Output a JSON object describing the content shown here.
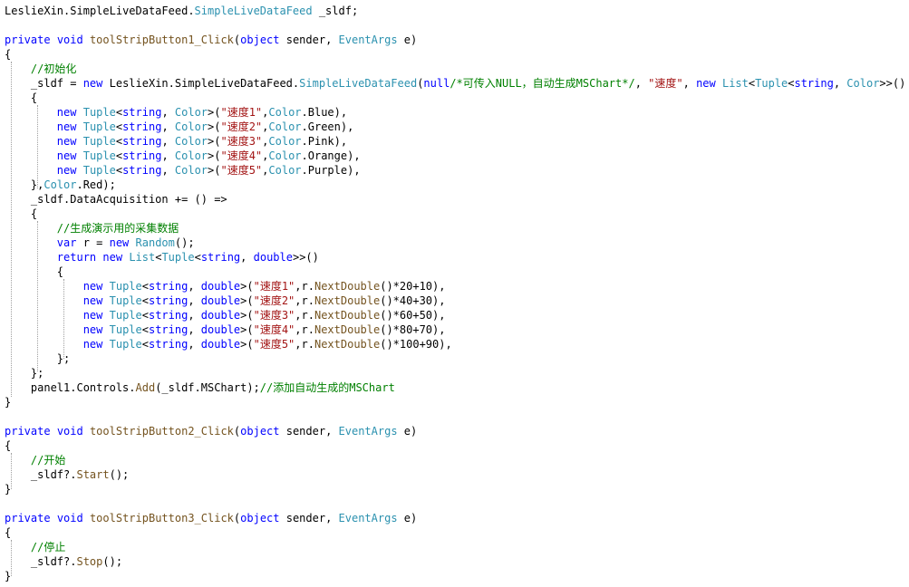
{
  "code_lines": [
    [
      [
        "id",
        "LeslieXin"
      ],
      [
        "punc",
        "."
      ],
      [
        "id",
        "SimpleLiveDataFeed"
      ],
      [
        "punc",
        "."
      ],
      [
        "type",
        "SimpleLiveDataFeed"
      ],
      [
        "punc",
        " _sldf;"
      ]
    ],
    [],
    [
      [
        "kw",
        "private"
      ],
      [
        "punc",
        " "
      ],
      [
        "kw",
        "void"
      ],
      [
        "punc",
        " "
      ],
      [
        "method",
        "toolStripButton1_Click"
      ],
      [
        "punc",
        "("
      ],
      [
        "kw",
        "object"
      ],
      [
        "punc",
        " sender, "
      ],
      [
        "type",
        "EventArgs"
      ],
      [
        "punc",
        " e)"
      ]
    ],
    [
      [
        "punc",
        "{"
      ]
    ],
    [
      [
        "punc",
        "    "
      ],
      [
        "com",
        "//初始化"
      ]
    ],
    [
      [
        "punc",
        "    _sldf = "
      ],
      [
        "kw",
        "new"
      ],
      [
        "punc",
        " LeslieXin.SimpleLiveDataFeed."
      ],
      [
        "type",
        "SimpleLiveDataFeed"
      ],
      [
        "punc",
        "("
      ],
      [
        "kw",
        "null"
      ],
      [
        "com",
        "/*可传入NULL，自动生成MSChart*/"
      ],
      [
        "punc",
        ", "
      ],
      [
        "str",
        "\"速度\""
      ],
      [
        "punc",
        ", "
      ],
      [
        "kw",
        "new"
      ],
      [
        "punc",
        " "
      ],
      [
        "type",
        "List"
      ],
      [
        "punc",
        "<"
      ],
      [
        "type",
        "Tuple"
      ],
      [
        "punc",
        "<"
      ],
      [
        "kw",
        "string"
      ],
      [
        "punc",
        ", "
      ],
      [
        "type",
        "Color"
      ],
      [
        "punc",
        ">>()"
      ]
    ],
    [
      [
        "punc",
        "    {"
      ]
    ],
    [
      [
        "punc",
        "        "
      ],
      [
        "kw",
        "new"
      ],
      [
        "punc",
        " "
      ],
      [
        "type",
        "Tuple"
      ],
      [
        "punc",
        "<"
      ],
      [
        "kw",
        "string"
      ],
      [
        "punc",
        ", "
      ],
      [
        "type",
        "Color"
      ],
      [
        "punc",
        ">("
      ],
      [
        "str",
        "\"速度1\""
      ],
      [
        "punc",
        ","
      ],
      [
        "type",
        "Color"
      ],
      [
        "punc",
        ".Blue),"
      ]
    ],
    [
      [
        "punc",
        "        "
      ],
      [
        "kw",
        "new"
      ],
      [
        "punc",
        " "
      ],
      [
        "type",
        "Tuple"
      ],
      [
        "punc",
        "<"
      ],
      [
        "kw",
        "string"
      ],
      [
        "punc",
        ", "
      ],
      [
        "type",
        "Color"
      ],
      [
        "punc",
        ">("
      ],
      [
        "str",
        "\"速度2\""
      ],
      [
        "punc",
        ","
      ],
      [
        "type",
        "Color"
      ],
      [
        "punc",
        ".Green),"
      ]
    ],
    [
      [
        "punc",
        "        "
      ],
      [
        "kw",
        "new"
      ],
      [
        "punc",
        " "
      ],
      [
        "type",
        "Tuple"
      ],
      [
        "punc",
        "<"
      ],
      [
        "kw",
        "string"
      ],
      [
        "punc",
        ", "
      ],
      [
        "type",
        "Color"
      ],
      [
        "punc",
        ">("
      ],
      [
        "str",
        "\"速度3\""
      ],
      [
        "punc",
        ","
      ],
      [
        "type",
        "Color"
      ],
      [
        "punc",
        ".Pink),"
      ]
    ],
    [
      [
        "punc",
        "        "
      ],
      [
        "kw",
        "new"
      ],
      [
        "punc",
        " "
      ],
      [
        "type",
        "Tuple"
      ],
      [
        "punc",
        "<"
      ],
      [
        "kw",
        "string"
      ],
      [
        "punc",
        ", "
      ],
      [
        "type",
        "Color"
      ],
      [
        "punc",
        ">("
      ],
      [
        "str",
        "\"速度4\""
      ],
      [
        "punc",
        ","
      ],
      [
        "type",
        "Color"
      ],
      [
        "punc",
        ".Orange),"
      ]
    ],
    [
      [
        "punc",
        "        "
      ],
      [
        "kw",
        "new"
      ],
      [
        "punc",
        " "
      ],
      [
        "type",
        "Tuple"
      ],
      [
        "punc",
        "<"
      ],
      [
        "kw",
        "string"
      ],
      [
        "punc",
        ", "
      ],
      [
        "type",
        "Color"
      ],
      [
        "punc",
        ">("
      ],
      [
        "str",
        "\"速度5\""
      ],
      [
        "punc",
        ","
      ],
      [
        "type",
        "Color"
      ],
      [
        "punc",
        ".Purple),"
      ]
    ],
    [
      [
        "punc",
        "    },"
      ],
      [
        "type",
        "Color"
      ],
      [
        "punc",
        ".Red);"
      ]
    ],
    [
      [
        "punc",
        "    _sldf.DataAcquisition += () =>"
      ]
    ],
    [
      [
        "punc",
        "    {"
      ]
    ],
    [
      [
        "punc",
        "        "
      ],
      [
        "com",
        "//生成演示用的采集数据"
      ]
    ],
    [
      [
        "punc",
        "        "
      ],
      [
        "kw",
        "var"
      ],
      [
        "punc",
        " r = "
      ],
      [
        "kw",
        "new"
      ],
      [
        "punc",
        " "
      ],
      [
        "type",
        "Random"
      ],
      [
        "punc",
        "();"
      ]
    ],
    [
      [
        "punc",
        "        "
      ],
      [
        "kw",
        "return"
      ],
      [
        "punc",
        " "
      ],
      [
        "kw",
        "new"
      ],
      [
        "punc",
        " "
      ],
      [
        "type",
        "List"
      ],
      [
        "punc",
        "<"
      ],
      [
        "type",
        "Tuple"
      ],
      [
        "punc",
        "<"
      ],
      [
        "kw",
        "string"
      ],
      [
        "punc",
        ", "
      ],
      [
        "kw",
        "double"
      ],
      [
        "punc",
        ">>()"
      ]
    ],
    [
      [
        "punc",
        "        {"
      ]
    ],
    [
      [
        "punc",
        "            "
      ],
      [
        "kw",
        "new"
      ],
      [
        "punc",
        " "
      ],
      [
        "type",
        "Tuple"
      ],
      [
        "punc",
        "<"
      ],
      [
        "kw",
        "string"
      ],
      [
        "punc",
        ", "
      ],
      [
        "kw",
        "double"
      ],
      [
        "punc",
        ">("
      ],
      [
        "str",
        "\"速度1\""
      ],
      [
        "punc",
        ",r."
      ],
      [
        "method",
        "NextDouble"
      ],
      [
        "punc",
        "()*20+10),"
      ]
    ],
    [
      [
        "punc",
        "            "
      ],
      [
        "kw",
        "new"
      ],
      [
        "punc",
        " "
      ],
      [
        "type",
        "Tuple"
      ],
      [
        "punc",
        "<"
      ],
      [
        "kw",
        "string"
      ],
      [
        "punc",
        ", "
      ],
      [
        "kw",
        "double"
      ],
      [
        "punc",
        ">("
      ],
      [
        "str",
        "\"速度2\""
      ],
      [
        "punc",
        ",r."
      ],
      [
        "method",
        "NextDouble"
      ],
      [
        "punc",
        "()*40+30),"
      ]
    ],
    [
      [
        "punc",
        "            "
      ],
      [
        "kw",
        "new"
      ],
      [
        "punc",
        " "
      ],
      [
        "type",
        "Tuple"
      ],
      [
        "punc",
        "<"
      ],
      [
        "kw",
        "string"
      ],
      [
        "punc",
        ", "
      ],
      [
        "kw",
        "double"
      ],
      [
        "punc",
        ">("
      ],
      [
        "str",
        "\"速度3\""
      ],
      [
        "punc",
        ",r."
      ],
      [
        "method",
        "NextDouble"
      ],
      [
        "punc",
        "()*60+50),"
      ]
    ],
    [
      [
        "punc",
        "            "
      ],
      [
        "kw",
        "new"
      ],
      [
        "punc",
        " "
      ],
      [
        "type",
        "Tuple"
      ],
      [
        "punc",
        "<"
      ],
      [
        "kw",
        "string"
      ],
      [
        "punc",
        ", "
      ],
      [
        "kw",
        "double"
      ],
      [
        "punc",
        ">("
      ],
      [
        "str",
        "\"速度4\""
      ],
      [
        "punc",
        ",r."
      ],
      [
        "method",
        "NextDouble"
      ],
      [
        "punc",
        "()*80+70),"
      ]
    ],
    [
      [
        "punc",
        "            "
      ],
      [
        "kw",
        "new"
      ],
      [
        "punc",
        " "
      ],
      [
        "type",
        "Tuple"
      ],
      [
        "punc",
        "<"
      ],
      [
        "kw",
        "string"
      ],
      [
        "punc",
        ", "
      ],
      [
        "kw",
        "double"
      ],
      [
        "punc",
        ">("
      ],
      [
        "str",
        "\"速度5\""
      ],
      [
        "punc",
        ",r."
      ],
      [
        "method",
        "NextDouble"
      ],
      [
        "punc",
        "()*100+90),"
      ]
    ],
    [
      [
        "punc",
        "        };"
      ]
    ],
    [
      [
        "punc",
        "    };"
      ]
    ],
    [
      [
        "punc",
        "    panel1.Controls."
      ],
      [
        "method",
        "Add"
      ],
      [
        "punc",
        "(_sldf.MSChart);"
      ],
      [
        "com",
        "//添加自动生成的MSChart"
      ]
    ],
    [
      [
        "punc",
        "}"
      ]
    ],
    [],
    [
      [
        "kw",
        "private"
      ],
      [
        "punc",
        " "
      ],
      [
        "kw",
        "void"
      ],
      [
        "punc",
        " "
      ],
      [
        "method",
        "toolStripButton2_Click"
      ],
      [
        "punc",
        "("
      ],
      [
        "kw",
        "object"
      ],
      [
        "punc",
        " sender, "
      ],
      [
        "type",
        "EventArgs"
      ],
      [
        "punc",
        " e)"
      ]
    ],
    [
      [
        "punc",
        "{"
      ]
    ],
    [
      [
        "punc",
        "    "
      ],
      [
        "com",
        "//开始"
      ]
    ],
    [
      [
        "punc",
        "    _sldf?."
      ],
      [
        "method",
        "Start"
      ],
      [
        "punc",
        "();"
      ]
    ],
    [
      [
        "punc",
        "}"
      ]
    ],
    [],
    [
      [
        "kw",
        "private"
      ],
      [
        "punc",
        " "
      ],
      [
        "kw",
        "void"
      ],
      [
        "punc",
        " "
      ],
      [
        "method",
        "toolStripButton3_Click"
      ],
      [
        "punc",
        "("
      ],
      [
        "kw",
        "object"
      ],
      [
        "punc",
        " sender, "
      ],
      [
        "type",
        "EventArgs"
      ],
      [
        "punc",
        " e)"
      ]
    ],
    [
      [
        "punc",
        "{"
      ]
    ],
    [
      [
        "punc",
        "    "
      ],
      [
        "com",
        "//停止"
      ]
    ],
    [
      [
        "punc",
        "    _sldf?."
      ],
      [
        "method",
        "Stop"
      ],
      [
        "punc",
        "();"
      ]
    ],
    [
      [
        "punc",
        "}"
      ]
    ]
  ],
  "colors": {
    "keyword": "#0000ff",
    "type": "#2b91af",
    "string": "#a31515",
    "comment": "#008000",
    "method": "#74531f",
    "text": "#000000",
    "background": "#ffffff",
    "indent_guide": "#a0a0a0"
  }
}
